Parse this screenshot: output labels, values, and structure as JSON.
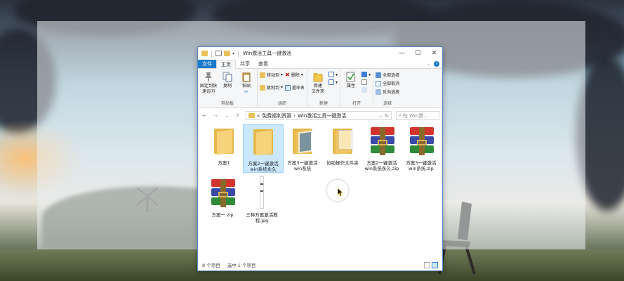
{
  "window": {
    "title": "Win激活工具一键激活",
    "controls": {
      "minimize": "—",
      "maximize": "☐",
      "close": "✕"
    }
  },
  "tabs": [
    "文件",
    "主页",
    "共享",
    "查看"
  ],
  "ribbon": {
    "clipboard": {
      "pin": "固定到快\n速访问",
      "copy": "复制",
      "paste": "粘贴",
      "label": "剪贴板"
    },
    "organize": {
      "move_to": "移动到",
      "copy_to": "复制到",
      "delete": "删除",
      "rename": "重命名",
      "label": "组织"
    },
    "new": {
      "new_folder": "新建\n文件夹",
      "label": "新建"
    },
    "open": {
      "properties": "属性",
      "label": "打开"
    },
    "select": {
      "select_all": "全部选择",
      "select_none": "全部取消",
      "invert": "反向选择",
      "label": "选择"
    }
  },
  "address": {
    "back": "←",
    "forward": "→",
    "up_arrow": "↑",
    "crumb_sep": "«",
    "crumb1": "免费福利资源",
    "crumb_arrow": "›",
    "crumb2": "Win激活工具一键激活",
    "refresh": "↻",
    "search_placeholder": "在 Win激..."
  },
  "items": [
    {
      "name": "方案1",
      "type": "folder"
    },
    {
      "name": "方案2一键激活\nwin系统永久",
      "type": "folder",
      "selected": true
    },
    {
      "name": "方案3一键激活\nwin系统",
      "type": "folder-doc"
    },
    {
      "name": "协助操作文件夹",
      "type": "folder-paper"
    },
    {
      "name": "方案2一键激活\nwin系统永久.zip",
      "type": "zip"
    },
    {
      "name": "方案3一键激活\nwin系统.zip",
      "type": "zip"
    },
    {
      "name": "方案一.zip",
      "type": "zip"
    },
    {
      "name": "三种方案激活教\n程.jpg",
      "type": "image"
    }
  ],
  "status": {
    "count": "8 个项目",
    "selected": "选中 1 个项目"
  },
  "colors": {
    "file_tab": "#1979ca",
    "folder": "#f6d37a",
    "selection": "#cce8ff"
  }
}
